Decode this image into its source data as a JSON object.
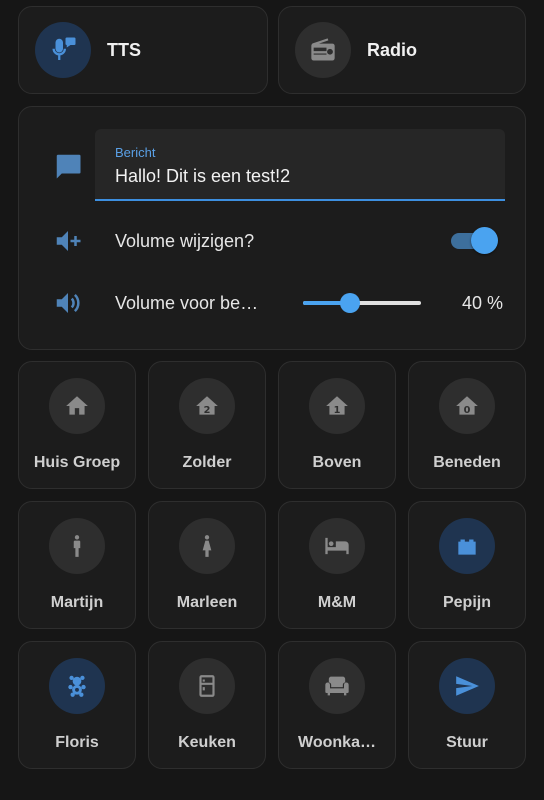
{
  "top_cards": [
    {
      "label": "TTS",
      "icon": "microphone-message-icon",
      "active": true
    },
    {
      "label": "Radio",
      "icon": "radio-icon",
      "active": false
    }
  ],
  "message": {
    "field_label": "Bericht",
    "value": "Hallo! Dit is een test!2"
  },
  "volume_change": {
    "label": "Volume wijzigen?",
    "toggled": true
  },
  "volume": {
    "label": "Volume voor be…",
    "value": 40,
    "value_text": "40 %"
  },
  "tiles": [
    {
      "label": "Huis Groep",
      "icon": "home-icon",
      "active": false
    },
    {
      "label": "Zolder",
      "icon": "home-floor-2-icon",
      "active": false
    },
    {
      "label": "Boven",
      "icon": "home-floor-1-icon",
      "active": false
    },
    {
      "label": "Beneden",
      "icon": "home-floor-0-icon",
      "active": false
    },
    {
      "label": "Martijn",
      "icon": "human-male-icon",
      "active": false
    },
    {
      "label": "Marleen",
      "icon": "human-female-icon",
      "active": false
    },
    {
      "label": "M&M",
      "icon": "bed-icon",
      "active": false
    },
    {
      "label": "Pepijn",
      "icon": "toy-brick-icon",
      "active": true
    },
    {
      "label": "Floris",
      "icon": "teddy-bear-icon",
      "active": true
    },
    {
      "label": "Keuken",
      "icon": "fridge-icon",
      "active": false
    },
    {
      "label": "Woonka…",
      "icon": "sofa-icon",
      "active": false
    },
    {
      "label": "Stuur",
      "icon": "send-icon",
      "active": true
    }
  ],
  "colors": {
    "accent": "#4aa3f0",
    "icon_grey": "#8a8a8a",
    "active_circle": "#1f3450",
    "inactive_circle": "#2e2e2e"
  }
}
